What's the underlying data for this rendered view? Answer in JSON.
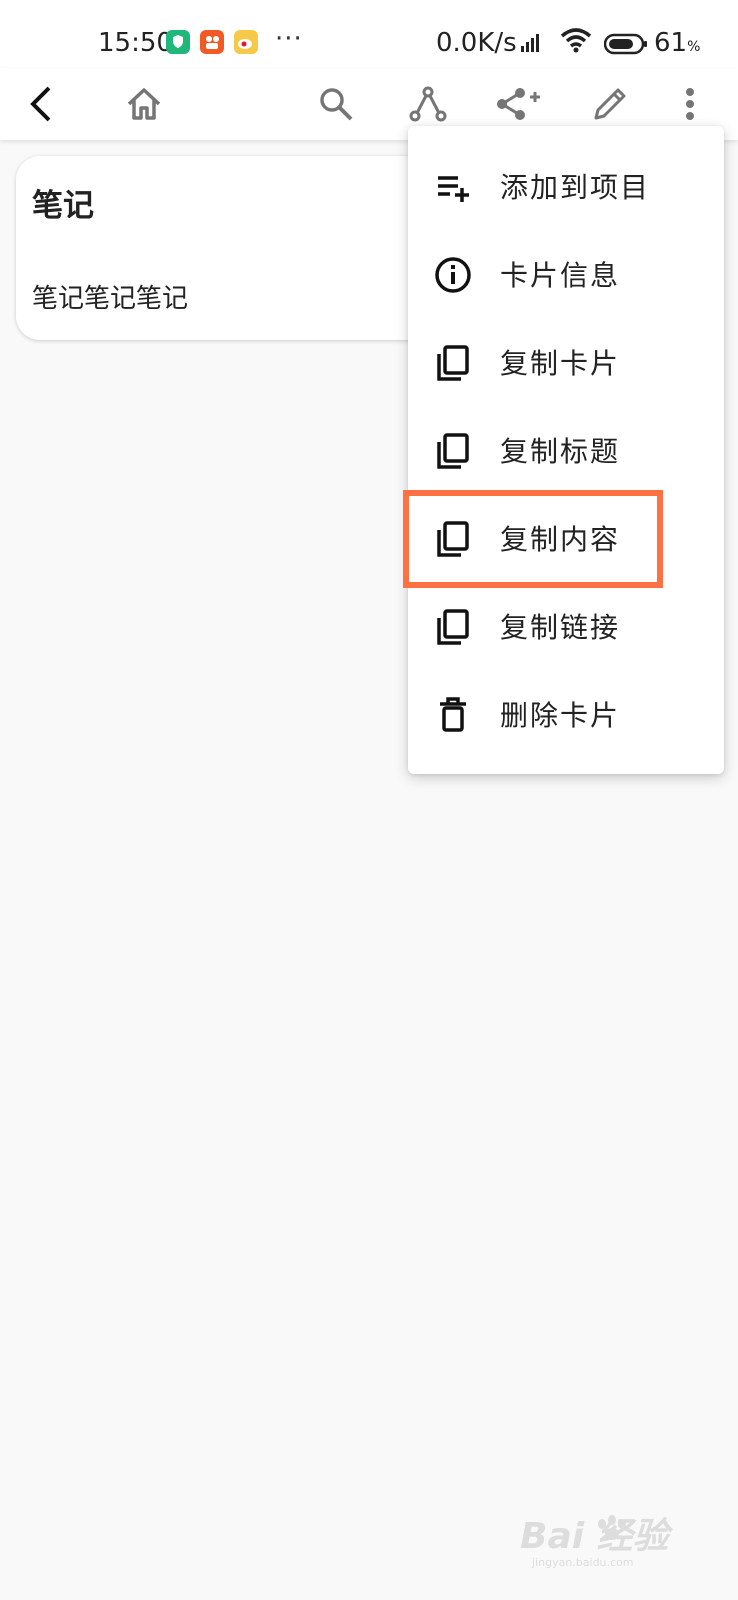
{
  "status_bar": {
    "time": "15:50",
    "dots": "···",
    "network_speed": "0.0K/s",
    "battery_percent": "61",
    "battery_unit": "%"
  },
  "toolbar": {
    "icons": [
      "back-arrow-icon",
      "home-icon",
      "search-icon",
      "graph-icon",
      "share-icon",
      "pencil-icon",
      "more-vertical-icon"
    ]
  },
  "card": {
    "title": "笔记",
    "body": "笔记笔记笔记"
  },
  "menu": {
    "items": [
      {
        "label": "添加到项目",
        "icon": "playlist-add-icon"
      },
      {
        "label": "卡片信息",
        "icon": "info-icon"
      },
      {
        "label": "复制卡片",
        "icon": "copy-icon"
      },
      {
        "label": "复制标题",
        "icon": "copy-icon"
      },
      {
        "label": "复制内容",
        "icon": "copy-icon"
      },
      {
        "label": "复制链接",
        "icon": "copy-icon"
      },
      {
        "label": "删除卡片",
        "icon": "trash-icon"
      }
    ]
  },
  "colors": {
    "highlight": "#ff7043",
    "icon_gray": "#757575",
    "background": "#f9f9f9"
  },
  "watermark": {
    "text": "Bai 经验",
    "sub": "jingyan.baidu.com"
  }
}
